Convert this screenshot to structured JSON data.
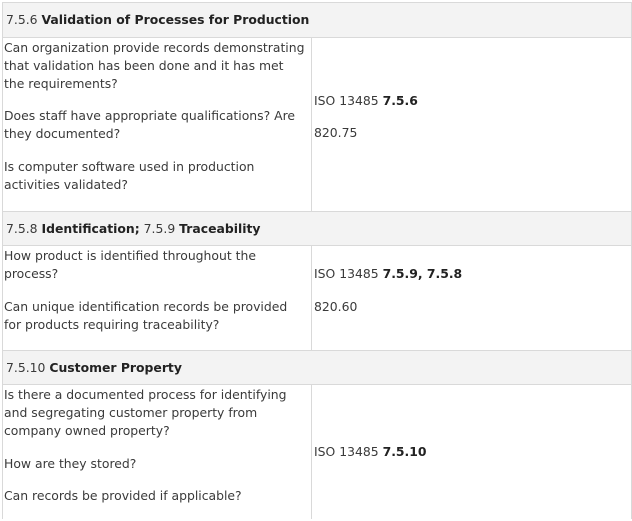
{
  "sections": [
    {
      "header_num": "7.5.6",
      "header_title": "Validation of Processes for Production",
      "questions": [
        "Can organization provide records demonstrating that validation has been done and it has met the requirements?",
        "Does staff have appropriate qualifications? Are they documented?",
        "Is computer software used in production activities validated?"
      ],
      "ref_prefix": "ISO 13485",
      "ref_bold": "7.5.6",
      "ref_secondary": "820.75"
    },
    {
      "header_num_a": "7.5.8",
      "header_title_a": "Identification;",
      "header_num_b": "7.5.9",
      "header_title_b": "Traceability",
      "questions": [
        "How product is identified throughout the process?",
        "Can unique identification records be provided for products requiring traceability?"
      ],
      "ref_prefix": "ISO 13485",
      "ref_bold": "7.5.9, 7.5.8",
      "ref_secondary": "820.60"
    },
    {
      "header_num": "7.5.10",
      "header_title": "Customer Property",
      "questions": [
        "Is there a documented process for identifying and segregating customer property from company owned property?",
        "How are they stored?",
        "Can records be provided if applicable?"
      ],
      "ref_prefix": "ISO 13485",
      "ref_bold": "7.5.10"
    }
  ]
}
